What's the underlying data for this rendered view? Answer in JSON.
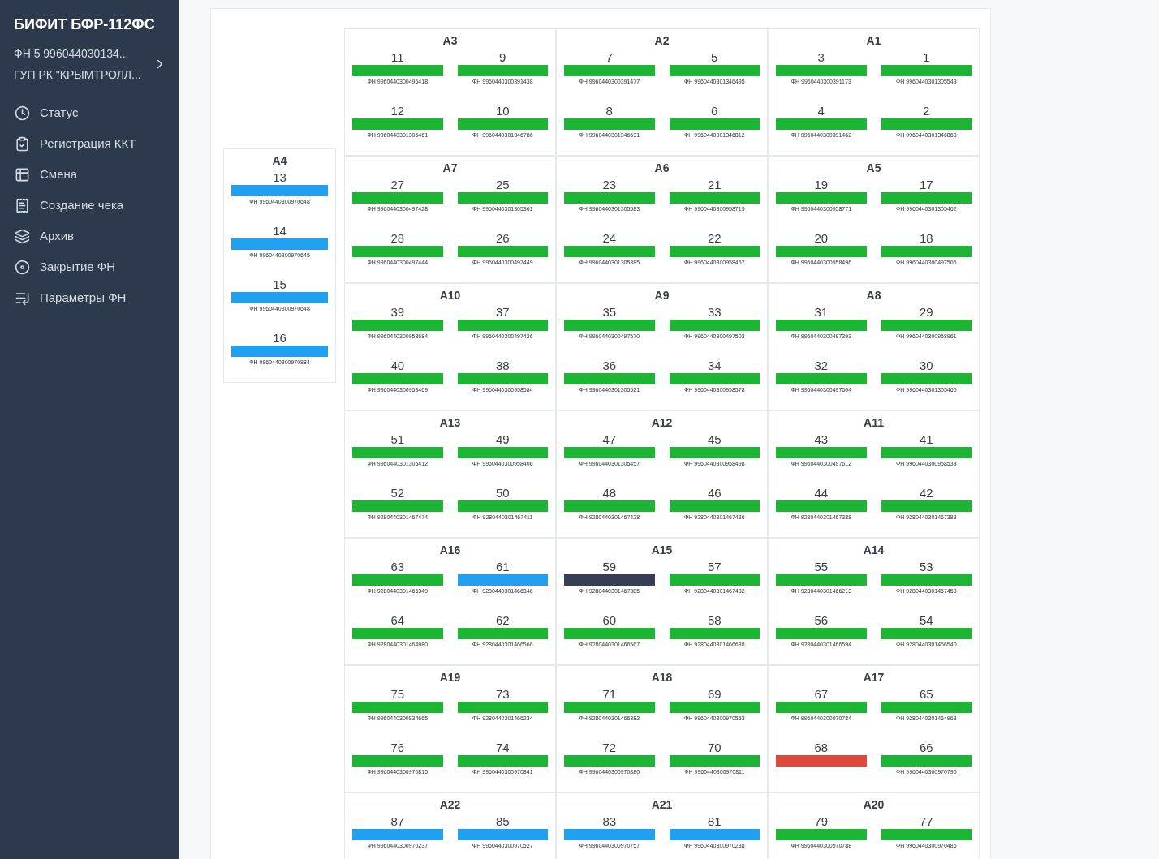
{
  "sidebar": {
    "title": "БИФИТ БФР-112ФС",
    "device_lines": [
      "ФН 5 996044030134...",
      "ГУП РК \"КРЫМТРОЛЛ..."
    ],
    "items": [
      {
        "label": "Статус"
      },
      {
        "label": "Регистрация ККТ"
      },
      {
        "label": "Смена"
      },
      {
        "label": "Создание чека"
      },
      {
        "label": "Архив"
      },
      {
        "label": "Закрытие ФН"
      },
      {
        "label": "Параметры ФН"
      }
    ]
  },
  "side_group": {
    "title": "A4",
    "slots": [
      {
        "number": "13",
        "color": "#22a0f0",
        "serial": "ФН 9960440300970648"
      },
      {
        "number": "14",
        "color": "#22a0f0",
        "serial": "ФН 9960440300970645"
      },
      {
        "number": "15",
        "color": "#22a0f0",
        "serial": "ФН 9960440300970648"
      },
      {
        "number": "16",
        "color": "#22a0f0",
        "serial": "ФН 9960440300970884"
      }
    ]
  },
  "groups": [
    {
      "title": "A3",
      "slots": [
        {
          "number": "11",
          "color": "#1db634",
          "serial": "ФН 9960440300496418"
        },
        {
          "number": "9",
          "color": "#1db634",
          "serial": "ФН 9960440300391438"
        },
        {
          "number": "12",
          "color": "#1db634",
          "serial": "ФН 9960440301305461"
        },
        {
          "number": "10",
          "color": "#1db634",
          "serial": "ФН 9960440301346786"
        }
      ]
    },
    {
      "title": "A2",
      "slots": [
        {
          "number": "7",
          "color": "#1db634",
          "serial": "ФН 9960440300391477"
        },
        {
          "number": "5",
          "color": "#1db634",
          "serial": "ФН 9960440301346495"
        },
        {
          "number": "8",
          "color": "#1db634",
          "serial": "ФН 9960440301346631"
        },
        {
          "number": "6",
          "color": "#1db634",
          "serial": "ФН 9960440301346812"
        }
      ]
    },
    {
      "title": "A1",
      "slots": [
        {
          "number": "3",
          "color": "#1db634",
          "serial": "ФН 9960440300391173"
        },
        {
          "number": "1",
          "color": "#1db634",
          "serial": "ФН 9960440301305543"
        },
        {
          "number": "4",
          "color": "#1db634",
          "serial": "ФН 9960440300391462"
        },
        {
          "number": "2",
          "color": "#1db634",
          "serial": "ФН 9960440301346863"
        }
      ]
    },
    {
      "title": "A7",
      "slots": [
        {
          "number": "27",
          "color": "#1db634",
          "serial": "ФН 9960440300497428"
        },
        {
          "number": "25",
          "color": "#1db634",
          "serial": "ФН 9960440301305361"
        },
        {
          "number": "28",
          "color": "#1db634",
          "serial": "ФН 9960440300497444"
        },
        {
          "number": "26",
          "color": "#1db634",
          "serial": "ФН 9960440300497449"
        }
      ]
    },
    {
      "title": "A6",
      "slots": [
        {
          "number": "23",
          "color": "#1db634",
          "serial": "ФН 9960440301305583"
        },
        {
          "number": "21",
          "color": "#1db634",
          "serial": "ФН 9960440300958719"
        },
        {
          "number": "24",
          "color": "#1db634",
          "serial": "ФН 9960440301305385"
        },
        {
          "number": "22",
          "color": "#1db634",
          "serial": "ФН 9960440300958457"
        }
      ]
    },
    {
      "title": "A5",
      "slots": [
        {
          "number": "19",
          "color": "#1db634",
          "serial": "ФН 9960440300958771"
        },
        {
          "number": "17",
          "color": "#1db634",
          "serial": "ФН 9960440301305462"
        },
        {
          "number": "20",
          "color": "#1db634",
          "serial": "ФН 9960440300958496"
        },
        {
          "number": "18",
          "color": "#1db634",
          "serial": "ФН 9960440300497506"
        }
      ]
    },
    {
      "title": "A10",
      "slots": [
        {
          "number": "39",
          "color": "#1db634",
          "serial": "ФН 9960440300958684"
        },
        {
          "number": "37",
          "color": "#1db634",
          "serial": "ФН 9960440300497426"
        },
        {
          "number": "40",
          "color": "#1db634",
          "serial": "ФН 9960440300958469"
        },
        {
          "number": "38",
          "color": "#1db634",
          "serial": "ФН 9960440300958584"
        }
      ]
    },
    {
      "title": "A9",
      "slots": [
        {
          "number": "35",
          "color": "#1db634",
          "serial": "ФН 9960440300497570"
        },
        {
          "number": "33",
          "color": "#1db634",
          "serial": "ФН 9960440300497503"
        },
        {
          "number": "36",
          "color": "#1db634",
          "serial": "ФН 9960440301305521"
        },
        {
          "number": "34",
          "color": "#1db634",
          "serial": "ФН 9960440300958578"
        }
      ]
    },
    {
      "title": "A8",
      "slots": [
        {
          "number": "31",
          "color": "#1db634",
          "serial": "ФН 9960440300497393"
        },
        {
          "number": "29",
          "color": "#1db634",
          "serial": "ФН 9960440300958961"
        },
        {
          "number": "32",
          "color": "#1db634",
          "serial": "ФН 9960440300497604"
        },
        {
          "number": "30",
          "color": "#1db634",
          "serial": "ФН 9960440301305460"
        }
      ]
    },
    {
      "title": "A13",
      "slots": [
        {
          "number": "51",
          "color": "#1db634",
          "serial": "ФН 9960440301305412"
        },
        {
          "number": "49",
          "color": "#1db634",
          "serial": "ФН 9960440300958406"
        },
        {
          "number": "52",
          "color": "#1db634",
          "serial": "ФН 9280440301467474"
        },
        {
          "number": "50",
          "color": "#1db634",
          "serial": "ФН 9280440301467411"
        }
      ]
    },
    {
      "title": "A12",
      "slots": [
        {
          "number": "47",
          "color": "#1db634",
          "serial": "ФН 9960440301305457"
        },
        {
          "number": "45",
          "color": "#1db634",
          "serial": "ФН 9960440300958498"
        },
        {
          "number": "48",
          "color": "#1db634",
          "serial": "ФН 9280440301467428"
        },
        {
          "number": "46",
          "color": "#1db634",
          "serial": "ФН 9280440301467436"
        }
      ]
    },
    {
      "title": "A11",
      "slots": [
        {
          "number": "43",
          "color": "#1db634",
          "serial": "ФН 9960440300497612"
        },
        {
          "number": "41",
          "color": "#1db634",
          "serial": "ФН 9960440300958538"
        },
        {
          "number": "44",
          "color": "#1db634",
          "serial": "ФН 9280440301467388"
        },
        {
          "number": "42",
          "color": "#1db634",
          "serial": "ФН 9280440301467383"
        }
      ]
    },
    {
      "title": "A16",
      "slots": [
        {
          "number": "63",
          "color": "#1db634",
          "serial": "ФН 9280440301466349"
        },
        {
          "number": "61",
          "color": "#22a0f0",
          "serial": "ФН 9280440301466346"
        },
        {
          "number": "64",
          "color": "#1db634",
          "serial": "ФН 9280440301464980"
        },
        {
          "number": "62",
          "color": "#1db634",
          "serial": "ФН 9280440301466566"
        }
      ]
    },
    {
      "title": "A15",
      "slots": [
        {
          "number": "59",
          "color": "#363f55",
          "serial": "ФН 9280440301467385"
        },
        {
          "number": "57",
          "color": "#1db634",
          "serial": "ФН 9280440301467432"
        },
        {
          "number": "60",
          "color": "#1db634",
          "serial": "ФН 9280440301466567"
        },
        {
          "number": "58",
          "color": "#1db634",
          "serial": "ФН 9280440301466638"
        }
      ]
    },
    {
      "title": "A14",
      "slots": [
        {
          "number": "55",
          "color": "#1db634",
          "serial": "ФН 9280440301466213"
        },
        {
          "number": "53",
          "color": "#1db634",
          "serial": "ФН 9280440301467458"
        },
        {
          "number": "56",
          "color": "#1db634",
          "serial": "ФН 9280440301466594"
        },
        {
          "number": "54",
          "color": "#1db634",
          "serial": "ФН 9280440301466540"
        }
      ]
    },
    {
      "title": "A19",
      "slots": [
        {
          "number": "75",
          "color": "#1db634",
          "serial": "ФН 9960440300834665"
        },
        {
          "number": "73",
          "color": "#1db634",
          "serial": "ФН 9280440301466234"
        },
        {
          "number": "76",
          "color": "#1db634",
          "serial": "ФН 9960440300970815"
        },
        {
          "number": "74",
          "color": "#1db634",
          "serial": "ФН 9960440300970841"
        }
      ]
    },
    {
      "title": "A18",
      "slots": [
        {
          "number": "71",
          "color": "#1db634",
          "serial": "ФН 9280440301466382"
        },
        {
          "number": "69",
          "color": "#1db634",
          "serial": "ФН 9960440300970553"
        },
        {
          "number": "72",
          "color": "#1db634",
          "serial": "ФН 9960440300970880"
        },
        {
          "number": "70",
          "color": "#1db634",
          "serial": "ФН 9960440300970811"
        }
      ]
    },
    {
      "title": "A17",
      "slots": [
        {
          "number": "67",
          "color": "#1db634",
          "serial": "ФН 9960440300970784"
        },
        {
          "number": "65",
          "color": "#1db634",
          "serial": "ФН 9280440301464963"
        },
        {
          "number": "68",
          "color": "#e0473d"
        },
        {
          "number": "66",
          "color": "#1db634",
          "serial": "ФН 9960440300970790"
        }
      ]
    },
    {
      "title": "A22",
      "slots": [
        {
          "number": "87",
          "color": "#22a0f0",
          "serial": "ФН 9960440300970237"
        },
        {
          "number": "85",
          "color": "#22a0f0",
          "serial": "ФН 9960440300970527"
        }
      ]
    },
    {
      "title": "A21",
      "slots": [
        {
          "number": "83",
          "color": "#22a0f0",
          "serial": "ФН 9960440300970757"
        },
        {
          "number": "81",
          "color": "#22a0f0",
          "serial": "ФН 9960440300970238"
        }
      ]
    },
    {
      "title": "A20",
      "slots": [
        {
          "number": "79",
          "color": "#1db634",
          "serial": "ФН 9960440300970788"
        },
        {
          "number": "77",
          "color": "#1db634",
          "serial": "ФН 9960440300970486"
        }
      ]
    }
  ]
}
